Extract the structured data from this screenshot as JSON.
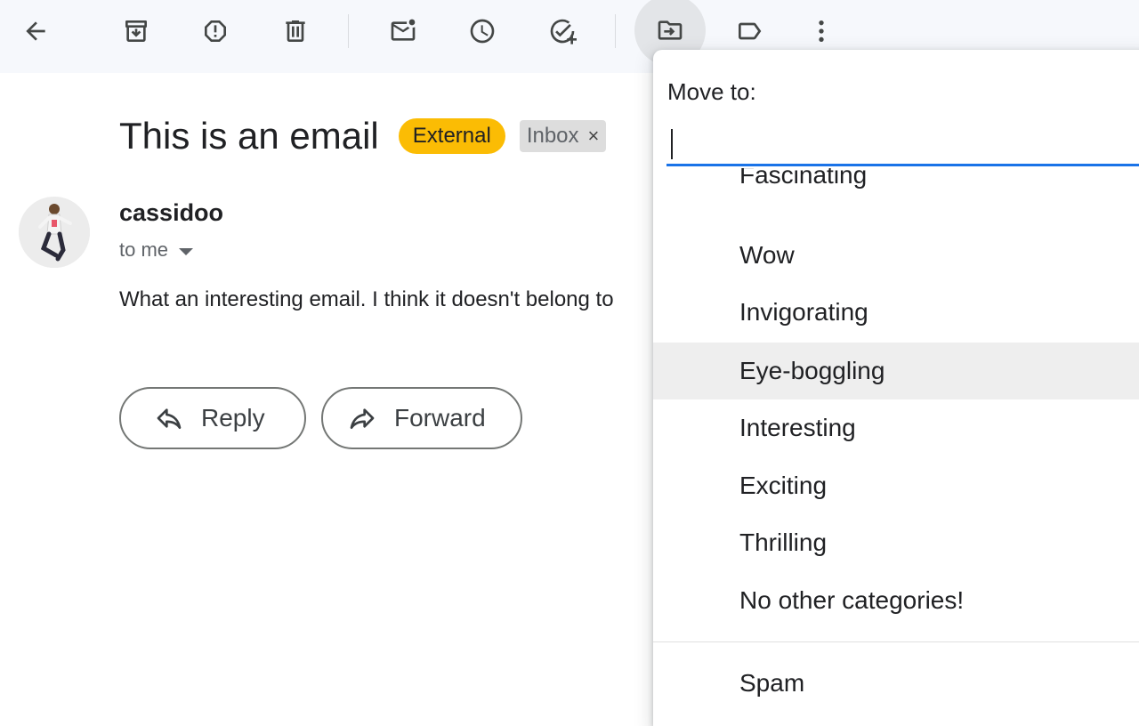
{
  "email": {
    "subject": "This is an email",
    "labels": [
      "External",
      "Inbox"
    ],
    "label_remove_glyph": "×",
    "sender": "cassidoo",
    "recipient": "to me",
    "body": "What an interesting email. I think it doesn't belong to",
    "actions": {
      "reply": "Reply",
      "forward": "Forward"
    }
  },
  "toolbar": {
    "icons": [
      "back-icon",
      "archive-icon",
      "report-spam-icon",
      "delete-icon",
      "mark-unread-icon",
      "snooze-icon",
      "add-to-tasks-icon",
      "move-to-icon",
      "label-icon",
      "more-options-icon"
    ],
    "active": "move-to-icon"
  },
  "move_menu": {
    "title": "Move to:",
    "search_value": "",
    "items": [
      {
        "label": "Fascinating"
      },
      {
        "label": "Wow"
      },
      {
        "label": "Invigorating"
      },
      {
        "label": "Eye-boggling"
      },
      {
        "label": "Interesting"
      },
      {
        "label": "Exciting"
      },
      {
        "label": "Thrilling"
      },
      {
        "label": "No other categories!"
      }
    ],
    "highlighted": "Eye-boggling",
    "extra_items": [
      {
        "label": "Spam"
      }
    ]
  },
  "colors": {
    "toolbar_bg": "#f6f8fc",
    "external_chip": "#fbbc04",
    "inbox_chip": "#dddddd",
    "input_underline": "#1a73e8",
    "hover": "#eeeeee"
  }
}
